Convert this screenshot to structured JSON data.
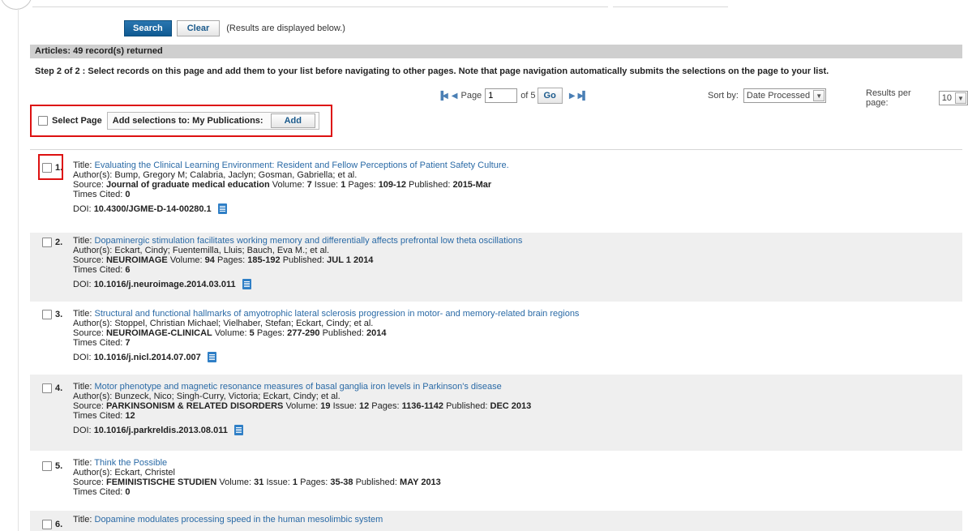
{
  "search": {
    "search_label": "Search",
    "clear_label": "Clear",
    "note": "(Results are displayed below.)"
  },
  "articles_header": "Articles: 49 record(s) returned",
  "step_text": "Step 2 of 2 : Select records on this page and add them to your list before navigating to other pages. Note that page navigation automatically submits the selections on the page to your list.",
  "pager": {
    "page_label": "Page",
    "page_value": "1",
    "of_label": "of 5",
    "go_label": "Go"
  },
  "sort": {
    "label": "Sort by:",
    "value": "Date Processed"
  },
  "results_per_page": {
    "label": "Results per page:",
    "value": "10"
  },
  "selection": {
    "select_page_label": "Select Page",
    "add_to_label": "Add selections to: My Publications:",
    "add_label": "Add"
  },
  "labels": {
    "title": "Title:",
    "authors": "Author(s):",
    "source": "Source:",
    "volume": "Volume:",
    "issue": "Issue:",
    "pages": "Pages:",
    "published": "Published:",
    "times_cited": "Times Cited:",
    "doi": "DOI:"
  },
  "records": [
    {
      "num": "1.",
      "title": "Evaluating the Clinical Learning Environment: Resident and Fellow Perceptions of Patient Safety Culture.",
      "authors": "Bump, Gregory M; Calabria, Jaclyn; Gosman, Gabriella; et al.",
      "journal": "Journal of graduate medical education",
      "volume": "7",
      "issue": "1",
      "pages": "109-12",
      "published": "2015-Mar",
      "times_cited": "0",
      "doi": "10.4300/JGME-D-14-00280.1"
    },
    {
      "num": "2.",
      "title": "Dopaminergic stimulation facilitates working memory and differentially affects prefrontal low theta oscillations",
      "authors": "Eckart, Cindy; Fuentemilla, Lluis; Bauch, Eva M.; et al.",
      "journal": "NEUROIMAGE",
      "volume": "94",
      "pages": "185-192",
      "published": "JUL 1 2014",
      "times_cited": "6",
      "doi": "10.1016/j.neuroimage.2014.03.011"
    },
    {
      "num": "3.",
      "title": "Structural and functional hallmarks of amyotrophic lateral sclerosis progression in motor- and memory-related brain regions",
      "authors": "Stoppel, Christian Michael; Vielhaber, Stefan; Eckart, Cindy; et al.",
      "journal": "NEUROIMAGE-CLINICAL",
      "volume": "5",
      "pages": "277-290",
      "published": "2014",
      "times_cited": "7",
      "doi": "10.1016/j.nicl.2014.07.007"
    },
    {
      "num": "4.",
      "title": "Motor phenotype and magnetic resonance measures of basal ganglia iron levels in Parkinson's disease",
      "authors": "Bunzeck, Nico; Singh-Curry, Victoria; Eckart, Cindy; et al.",
      "journal": "PARKINSONISM & RELATED DISORDERS",
      "volume": "19",
      "issue": "12",
      "pages": "1136-1142",
      "published": "DEC 2013",
      "times_cited": "12",
      "doi": "10.1016/j.parkreldis.2013.08.011"
    },
    {
      "num": "5.",
      "title": "Think the Possible",
      "authors": "Eckart, Christel",
      "journal": "FEMINISTISCHE STUDIEN",
      "volume": "31",
      "issue": "1",
      "pages": "35-38",
      "published": "MAY 2013",
      "times_cited": "0"
    },
    {
      "num": "6.",
      "title": "Dopamine modulates processing speed in the human mesolimbic system"
    }
  ],
  "colors": {
    "accent": "#1a5a8c",
    "link": "#2a6aa6",
    "highlight": "#dd1111",
    "band": "#efefef",
    "header_bar": "#cfcfcf"
  }
}
